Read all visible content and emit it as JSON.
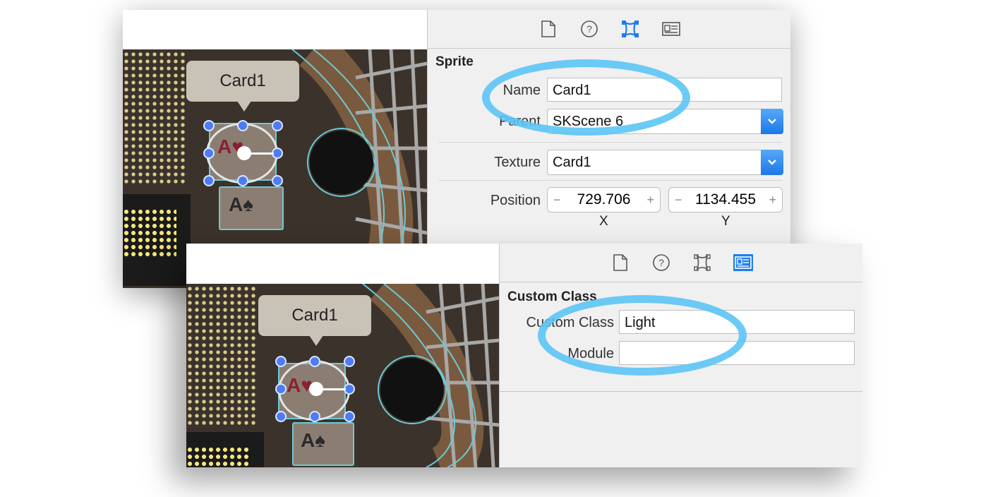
{
  "back_window": {
    "scene_callout": "Card1",
    "section_title": "Sprite",
    "name_label": "Name",
    "name_value": "Card1",
    "parent_label": "Parent",
    "parent_value": "SKScene 6",
    "texture_label": "Texture",
    "texture_value": "Card1",
    "position_label": "Position",
    "position_x": "729.706",
    "position_y": "1134.455",
    "x_label": "X",
    "y_label": "Y",
    "minus_glyph": "−",
    "plus_glyph": "+"
  },
  "front_window": {
    "scene_callout": "Card1",
    "section_title": "Custom Class",
    "class_label": "Custom Class",
    "class_value": "Light",
    "module_label": "Module",
    "module_value": ""
  },
  "card_glyphs": {
    "hearts": "A♥",
    "spades": "A♠"
  },
  "colors": {
    "highlight_ring": "#5cc4f5",
    "selected_tab": "#1e7ef0",
    "handle": "#4d7cf5"
  },
  "icons": [
    "file-inspector-icon",
    "quick-help-icon",
    "attributes-inspector-icon",
    "identity-inspector-icon"
  ]
}
